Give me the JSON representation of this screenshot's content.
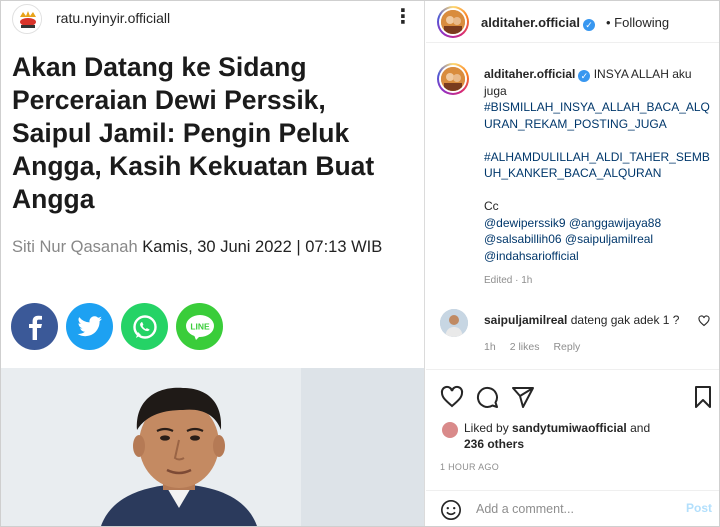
{
  "media": {
    "account": "ratu.nyinyir.officiall",
    "menu_icon": "more-vertical-icon",
    "headline": "Akan Datang ke Sidang Perceraian Dewi Perssik, Saipul Jamil: Pengin Peluk Angga, Kasih Kekuatan Buat Angga",
    "author": "Siti Nur Qasanah",
    "date": "Kamis, 30 Juni 2022 | 07:13 WIB",
    "share_buttons": [
      {
        "icon": "facebook-icon",
        "color": "#3b5998",
        "glyph": "f"
      },
      {
        "icon": "twitter-icon",
        "color": "#1da1f2",
        "glyph": ""
      },
      {
        "icon": "whatsapp-icon",
        "color": "#25d366",
        "glyph": ""
      },
      {
        "icon": "line-icon",
        "color": "#3acd3a",
        "glyph": "LINE"
      }
    ]
  },
  "panel": {
    "username": "alditaher.official",
    "following_label": "Following",
    "caption": {
      "username": "alditaher.official",
      "text": "INSYA ALLAH aku juga",
      "hashtag1": "#BISMILLAH_INSYA_ALLAH_BACA_ALQURAN_REKAM_POSTING_JUGA",
      "hashtag2": "#ALHAMDULILLAH_ALDI_TAHER_SEMBUH_KANKER_BACA_ALQURAN",
      "cc_label": "Cc",
      "mentions": "@dewiperssik9 @anggawijaya88 @salsabillih06 @saipuljamilreal @indahsariofficial",
      "meta": "Edited · 1h"
    },
    "reply": {
      "username": "saipuljamilreal",
      "text": "dateng gak adek 1 ?",
      "time": "1h",
      "likes": "2 likes",
      "reply_label": "Reply"
    },
    "liked_by": {
      "prefix": "Liked by",
      "user": "sandytumiwaofficial",
      "suffix": "and",
      "others": "236 others"
    },
    "timestamp": "1 HOUR AGO",
    "comment_placeholder": "Add a comment...",
    "post_label": "Post"
  }
}
